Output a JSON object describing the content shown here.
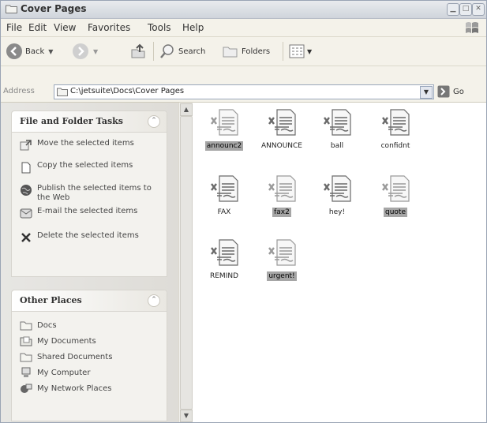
{
  "window": {
    "title": "Cover Pages"
  },
  "menu": [
    "File",
    "Edit",
    "View",
    "Favorites",
    "Tools",
    "Help"
  ],
  "toolbar": {
    "back": "Back",
    "search": "Search",
    "folders": "Folders"
  },
  "address": {
    "label": "Address",
    "path": "C:\\jetsuite\\Docs\\Cover Pages",
    "go": "Go"
  },
  "tasks": {
    "title": "File and Folder Tasks",
    "items": [
      {
        "label": "Move the selected items",
        "icon": "move-icon"
      },
      {
        "label": "Copy the selected items",
        "icon": "copy-icon"
      },
      {
        "label": "Publish the selected items to the Web",
        "icon": "globe-icon"
      },
      {
        "label": "E-mail the selected items",
        "icon": "email-icon"
      },
      {
        "label": "Delete the selected items",
        "icon": "delete-icon"
      }
    ]
  },
  "places": {
    "title": "Other Places",
    "items": [
      {
        "label": "Docs",
        "icon": "folder-icon"
      },
      {
        "label": "My Documents",
        "icon": "my-documents-icon"
      },
      {
        "label": "Shared Documents",
        "icon": "folder-icon"
      },
      {
        "label": "My Computer",
        "icon": "computer-icon"
      },
      {
        "label": "My Network Places",
        "icon": "network-icon"
      }
    ]
  },
  "files": [
    {
      "name": "announc2",
      "selected": true
    },
    {
      "name": "ANNOUNCE",
      "selected": false
    },
    {
      "name": "ball",
      "selected": false
    },
    {
      "name": "confidnt",
      "selected": false
    },
    {
      "name": "FAX",
      "selected": false
    },
    {
      "name": "fax2",
      "selected": true
    },
    {
      "name": "hey!",
      "selected": false
    },
    {
      "name": "quote",
      "selected": true
    },
    {
      "name": "REMIND",
      "selected": false
    },
    {
      "name": "urgent!",
      "selected": true
    }
  ]
}
